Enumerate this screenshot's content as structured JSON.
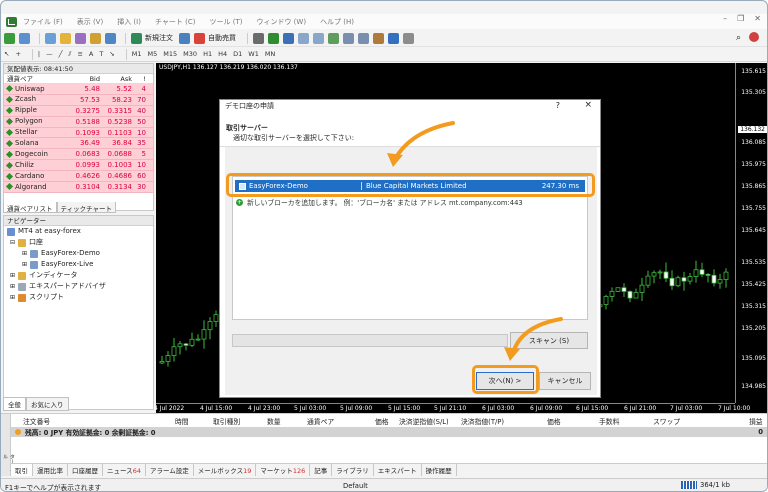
{
  "menu": {
    "items": [
      "ファイル (F)",
      "表示 (V)",
      "挿入 (I)",
      "チャート (C)",
      "ツール (T)",
      "ウィンドウ (W)",
      "ヘルプ (H)"
    ]
  },
  "toolbar": {
    "new_order": "新規注文",
    "auto_trading": "自動売買",
    "timeframes": [
      "M1",
      "M5",
      "M15",
      "M30",
      "H1",
      "H4",
      "D1",
      "W1",
      "MN"
    ]
  },
  "market_watch": {
    "title": "気配値表示: 08:41:50",
    "col_symbol": "通貨ペア",
    "col_bid": "Bid",
    "col_ask": "Ask",
    "col_spread": "!",
    "rows": [
      {
        "symbol": "Uniswap",
        "bid": "5.48",
        "ask": "5.52",
        "spread": "4"
      },
      {
        "symbol": "Zcash",
        "bid": "57.53",
        "ask": "58.23",
        "spread": "70"
      },
      {
        "symbol": "Ripple",
        "bid": "0.3275",
        "ask": "0.3315",
        "spread": "40"
      },
      {
        "symbol": "Polygon",
        "bid": "0.5188",
        "ask": "0.5238",
        "spread": "50"
      },
      {
        "symbol": "Stellar",
        "bid": "0.1093",
        "ask": "0.1103",
        "spread": "10"
      },
      {
        "symbol": "Solana",
        "bid": "36.49",
        "ask": "36.84",
        "spread": "35"
      },
      {
        "symbol": "Dogecoin",
        "bid": "0.0683",
        "ask": "0.0688",
        "spread": "5"
      },
      {
        "symbol": "Chiliz",
        "bid": "0.0993",
        "ask": "0.1003",
        "spread": "10"
      },
      {
        "symbol": "Cardano",
        "bid": "0.4626",
        "ask": "0.4686",
        "spread": "60"
      },
      {
        "symbol": "Algorand",
        "bid": "0.3104",
        "ask": "0.3134",
        "spread": "30"
      }
    ],
    "tabs": [
      "通貨ペアリスト",
      "ティックチャート"
    ]
  },
  "navigator": {
    "title": "ナビゲーター",
    "root": "MT4 at easy-forex",
    "accounts_label": "口座",
    "account_demo": "EasyForex-Demo",
    "account_live": "EasyForex-Live",
    "indicators": "インディケータ",
    "experts": "エキスパートアドバイザ",
    "scripts": "スクリプト",
    "tabs": [
      "全般",
      "お気に入り"
    ]
  },
  "chart": {
    "label": "USDJPY,H1  136.127 136.219 136.020 136.137",
    "prices": [
      "135.615",
      "135.305",
      "136.132",
      "136.085",
      "135.975",
      "135.865",
      "135.755",
      "135.645",
      "135.535",
      "135.425",
      "135.315",
      "135.205",
      "135.095",
      "134.985"
    ],
    "current_price": "136.132",
    "times": [
      "4 Jul 2022",
      "4 Jul 15:00",
      "4 Jul 23:00",
      "5 Jul 03:00",
      "5 Jul 09:00",
      "5 Jul 15:00",
      "5 Jul 21:10",
      "6 Jul 03:00",
      "6 Jul 09:00",
      "6 Jul 15:00",
      "6 Jul 21:00",
      "7 Jul 03:00",
      "7 Jul 10:00"
    ]
  },
  "dialog": {
    "title": "デモ口座の申請",
    "help": "?",
    "close": "×",
    "heading": "取引サーバー",
    "subheading": "適切な取引サーバーを選択して下さい:",
    "server_name": "EasyForex-Demo",
    "server_company": "Blue Capital Markets Limited",
    "server_ping": "247.30 ms",
    "add_text": "新しいブローカを追加します。 例：'ブローカ名' または アドレス mt.company.com:443",
    "scan_button": "スキャン (S)",
    "next_button": "次へ(N) >",
    "cancel_button": "キャンセル"
  },
  "terminal": {
    "columns": [
      "注文番号",
      "時間",
      "取引種別",
      "数量",
      "通貨ペア",
      "価格",
      "決済逆指値(S/L)",
      "決済指値(T/P)",
      "価格",
      "手数料",
      "スワップ",
      "損益"
    ],
    "balance_text": "残高: 0 JPY  有効証拠金: 0  余剰証拠金: 0",
    "balance_value": "0",
    "side_label": "ターミナル",
    "tabs": [
      {
        "label": "取引",
        "count": ""
      },
      {
        "label": "運用比率",
        "count": ""
      },
      {
        "label": "口座履歴",
        "count": ""
      },
      {
        "label": "ニュース",
        "count": "64"
      },
      {
        "label": "アラーム設定",
        "count": ""
      },
      {
        "label": "メールボックス",
        "count": "19"
      },
      {
        "label": "マーケット",
        "count": "126"
      },
      {
        "label": "記事",
        "count": ""
      },
      {
        "label": "ライブラリ",
        "count": ""
      },
      {
        "label": "エキスパート",
        "count": ""
      },
      {
        "label": "操作履歴",
        "count": ""
      }
    ]
  },
  "status": {
    "help": "F1キーでヘルプが表示されます",
    "profile": "Default",
    "connection": "364/1 kb"
  },
  "colors": {
    "highlight": "#f39b1e",
    "selection": "#1f6fc6",
    "market_row": "#ffcfd6",
    "chart_bg": "#000000"
  }
}
